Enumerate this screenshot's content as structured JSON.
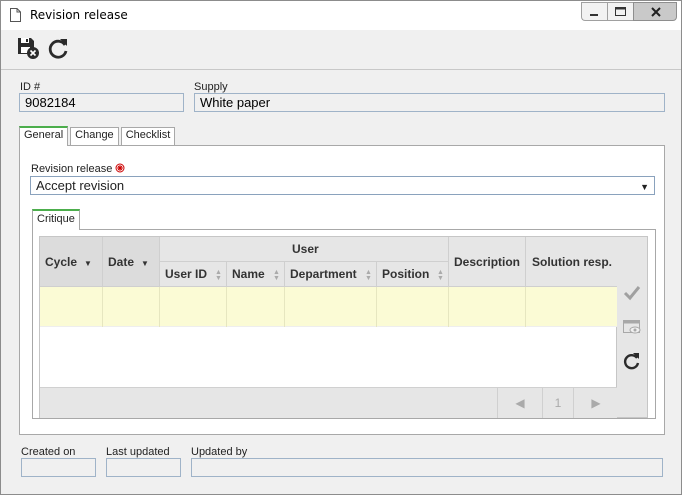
{
  "window": {
    "title": "Revision release"
  },
  "form": {
    "id_label": "ID #",
    "id_value": "9082184",
    "supply_label": "Supply",
    "supply_value": "White paper"
  },
  "tabs": [
    {
      "label": "General"
    },
    {
      "label": "Change"
    },
    {
      "label": "Checklist"
    }
  ],
  "general": {
    "revision_label": "Revision release",
    "revision_value": "Accept revision",
    "critique_tab": "Critique"
  },
  "grid": {
    "group_header": "User",
    "columns": {
      "cycle": "Cycle",
      "date": "Date",
      "user_id": "User ID",
      "name": "Name",
      "department": "Department",
      "position": "Position",
      "description": "Description",
      "solution": "Solution resp."
    },
    "page": "1"
  },
  "footer": {
    "created_label": "Created on",
    "updated_label": "Last updated",
    "updated_by_label": "Updated by"
  },
  "colors": {
    "accent": "#4cae4c",
    "row_highlight": "#fbfbd5",
    "required": "#cc0000"
  }
}
